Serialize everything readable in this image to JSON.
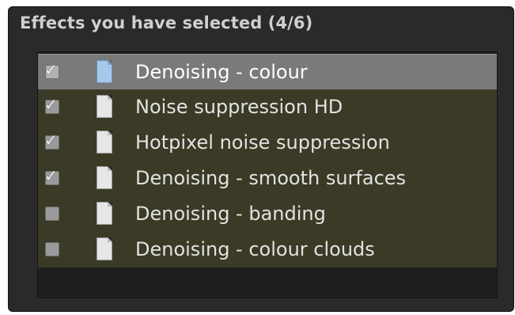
{
  "panel": {
    "title": "Effects you have selected (4/6)"
  },
  "effects": [
    {
      "label": "Denoising - colour",
      "checked": true,
      "selected": true
    },
    {
      "label": "Noise suppression HD",
      "checked": true,
      "selected": false
    },
    {
      "label": "Hotpixel noise suppression",
      "checked": true,
      "selected": false
    },
    {
      "label": "Denoising - smooth surfaces",
      "checked": true,
      "selected": false
    },
    {
      "label": "Denoising - banding",
      "checked": false,
      "selected": false
    },
    {
      "label": "Denoising - colour clouds",
      "checked": false,
      "selected": false
    }
  ],
  "icons": {
    "checkbox": "checkbox-icon",
    "document": "document-icon"
  },
  "colors": {
    "panel_bg": "#2a2a2a",
    "row_bg": "#3a3a26",
    "selected_row_bg": "#7a7a7a",
    "text": "#e2e2e2",
    "title_text": "#cfcfcf"
  }
}
